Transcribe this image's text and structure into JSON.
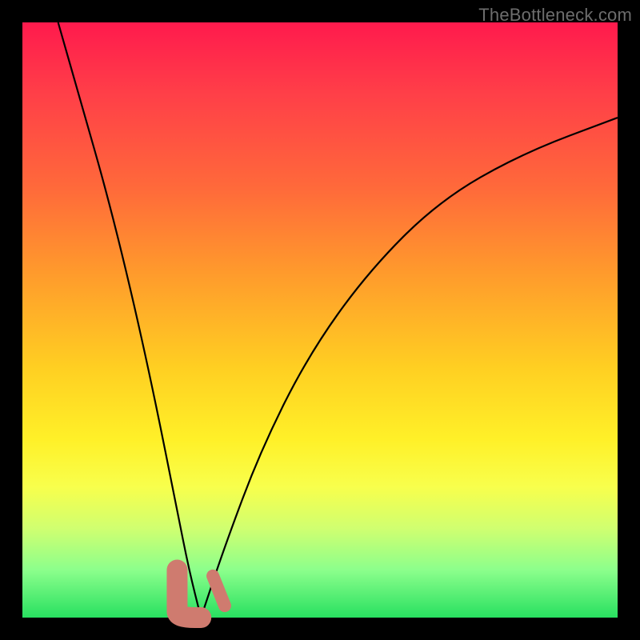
{
  "watermark": "TheBottleneck.com",
  "colors": {
    "frame_bg": "#000000",
    "gradient_top": "#ff1a4d",
    "gradient_bottom": "#28e060",
    "curve": "#000000",
    "marker": "#cf7b6f"
  },
  "chart_data": {
    "type": "line",
    "title": "",
    "xlabel": "",
    "ylabel": "",
    "xlim": [
      0,
      100
    ],
    "ylim": [
      0,
      100
    ],
    "grid": false,
    "description": "V-shaped bottleneck curve on a rainbow heat gradient (red=bad at top, green=good at bottom). Two black curves descend from the top-left and upper-right toward a trough near x≈30. A short salmon-colored squiggle highlights the bottom of the trough.",
    "series": [
      {
        "name": "left-descending",
        "x": [
          6,
          10,
          14,
          18,
          22,
          26,
          28,
          30
        ],
        "y": [
          100,
          86,
          72,
          56,
          38,
          18,
          8,
          0
        ]
      },
      {
        "name": "right-ascending",
        "x": [
          30,
          34,
          40,
          48,
          58,
          70,
          84,
          100
        ],
        "y": [
          0,
          12,
          28,
          44,
          58,
          70,
          78,
          84
        ]
      }
    ],
    "trough": {
      "x_start": 26,
      "x_end": 34,
      "y_min": 0,
      "y_max": 8
    },
    "background_gradient": "vertical rainbow (red→orange→yellow→green)"
  }
}
